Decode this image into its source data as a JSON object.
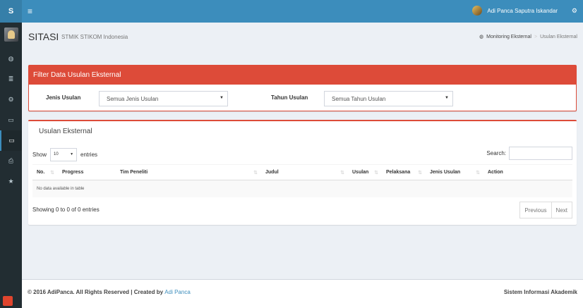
{
  "brand": {
    "letter": "S"
  },
  "sidebar": {
    "items": [
      {
        "icon": "dashboard-icon",
        "glyph": "◍"
      },
      {
        "icon": "database-icon",
        "glyph": "≣"
      },
      {
        "icon": "cogs-icon",
        "glyph": "⚙"
      },
      {
        "icon": "desktop-icon",
        "glyph": "▭"
      },
      {
        "icon": "desktop-icon",
        "glyph": "▭",
        "active": true
      },
      {
        "icon": "print-icon",
        "glyph": "⎙"
      },
      {
        "icon": "star-icon",
        "glyph": "★"
      }
    ]
  },
  "topbar": {
    "menu_glyph": "≡",
    "user_name": "Adi Panca Saputra Iskandar",
    "gears_glyph": "⚙"
  },
  "header": {
    "title": "SITASI",
    "subtitle": "STMIK STIKOM Indonesia",
    "breadcrumb": {
      "home": "Monitoring Eksternal",
      "sep": ">",
      "current": "Usulan Eksternal"
    }
  },
  "filter": {
    "heading": "Filter Data Usulan Eksternal",
    "jenis_label": "Jenis Usulan",
    "jenis_value": "Semua Jenis Usulan",
    "tahun_label": "Tahun Usulan",
    "tahun_value": "Semua Tahun Usulan"
  },
  "table_box": {
    "title": "Usulan Eksternal",
    "show_label": "Show",
    "length_value": "10",
    "entries_label": "entries",
    "search_label": "Search:",
    "columns": [
      "No.",
      "Progress",
      "Tim Peneliti",
      "Judul",
      "Usulan",
      "Pelaksana",
      "Jenis Usulan",
      "Action"
    ],
    "empty_message": "No data available in table",
    "info": "Showing 0 to 0 of 0 entries",
    "prev": "Previous",
    "next": "Next"
  },
  "footer": {
    "copyright": "© 2016 AdiPanca. All Rights Reserved | Created by",
    "author": "Adi Panca",
    "app_name": "Sistem Informasi Akademik"
  },
  "colors": {
    "primary": "#3c8dbc",
    "danger": "#dd4b39",
    "sidebar": "#222d32"
  }
}
